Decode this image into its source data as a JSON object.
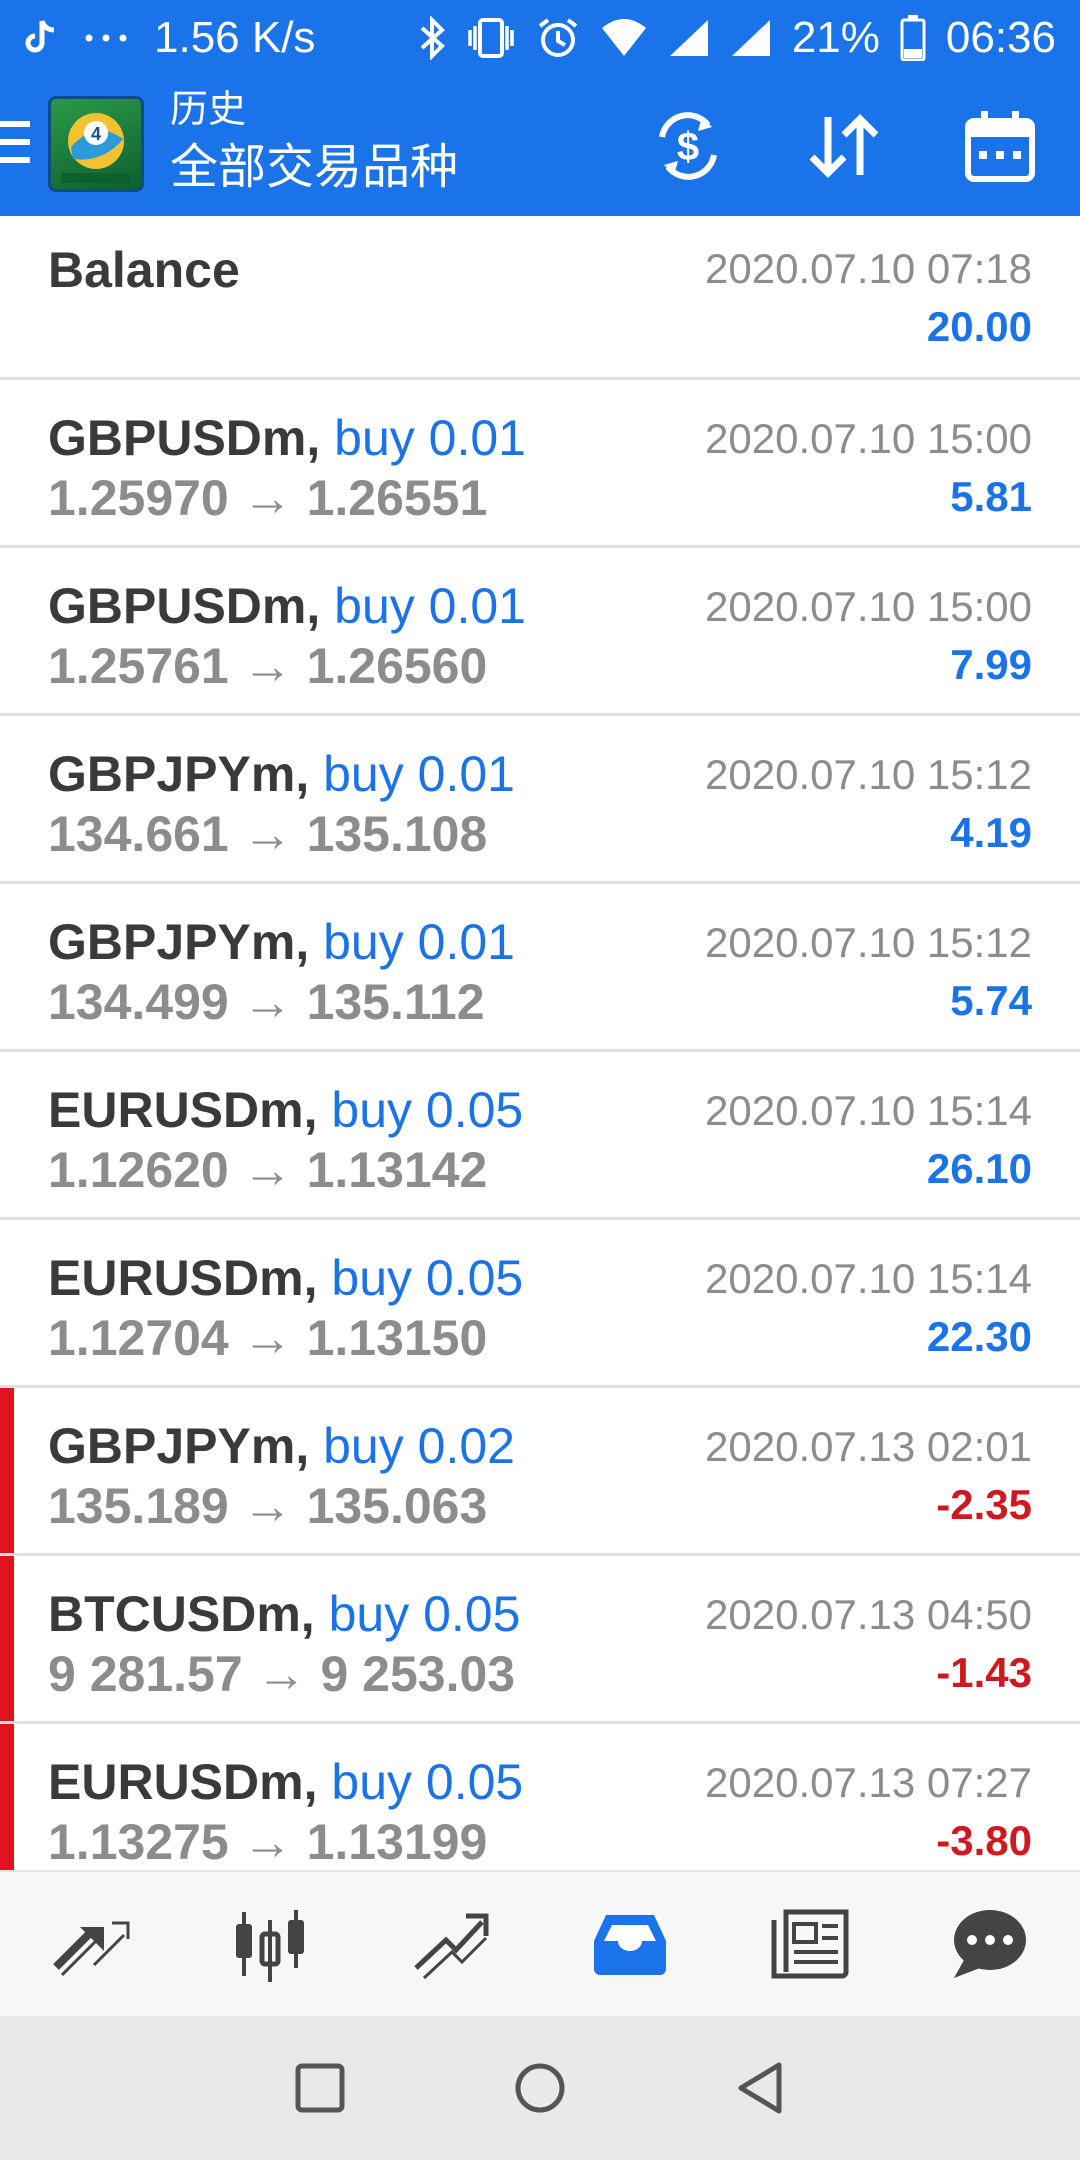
{
  "status_bar": {
    "net_speed": "1.56 K/s",
    "battery": "21%",
    "time": "06:36"
  },
  "app_bar": {
    "title": "历史",
    "subtitle": "全部交易品种"
  },
  "balance": {
    "label": "Balance",
    "date": "2020.07.10 07:18",
    "amount": "20.00"
  },
  "trades": [
    {
      "symbol": "GBPUSDm,",
      "type": "buy 0.01",
      "open": "1.25970",
      "close": "1.26551",
      "date": "2020.07.10 15:00",
      "profit": "5.81",
      "loss": false
    },
    {
      "symbol": "GBPUSDm,",
      "type": "buy 0.01",
      "open": "1.25761",
      "close": "1.26560",
      "date": "2020.07.10 15:00",
      "profit": "7.99",
      "loss": false
    },
    {
      "symbol": "GBPJPYm,",
      "type": "buy 0.01",
      "open": "134.661",
      "close": "135.108",
      "date": "2020.07.10 15:12",
      "profit": "4.19",
      "loss": false
    },
    {
      "symbol": "GBPJPYm,",
      "type": "buy 0.01",
      "open": "134.499",
      "close": "135.112",
      "date": "2020.07.10 15:12",
      "profit": "5.74",
      "loss": false
    },
    {
      "symbol": "EURUSDm,",
      "type": "buy 0.05",
      "open": "1.12620",
      "close": "1.13142",
      "date": "2020.07.10 15:14",
      "profit": "26.10",
      "loss": false
    },
    {
      "symbol": "EURUSDm,",
      "type": "buy 0.05",
      "open": "1.12704",
      "close": "1.13150",
      "date": "2020.07.10 15:14",
      "profit": "22.30",
      "loss": false
    },
    {
      "symbol": "GBPJPYm,",
      "type": "buy 0.02",
      "open": "135.189",
      "close": "135.063",
      "date": "2020.07.13 02:01",
      "profit": "-2.35",
      "loss": true
    },
    {
      "symbol": "BTCUSDm,",
      "type": "buy 0.05",
      "open": "9 281.57",
      "close": "9 253.03",
      "date": "2020.07.13 04:50",
      "profit": "-1.43",
      "loss": true
    },
    {
      "symbol": "EURUSDm,",
      "type": "buy 0.05",
      "open": "1.13275",
      "close": "1.13199",
      "date": "2020.07.13 07:27",
      "profit": "-3.80",
      "loss": true
    }
  ],
  "arrow": "→",
  "colors": {
    "accent": "#1a73e8",
    "loss": "#d0191f",
    "loss_bar": "#e0141e"
  },
  "icons": {
    "status": [
      "tiktok-icon",
      "more-icon",
      "bluetooth-icon",
      "vibrate-icon",
      "alarm-icon",
      "wifi-icon",
      "signal-icon",
      "signal-icon",
      "battery-icon"
    ],
    "app_bar": [
      "menu-icon",
      "currency-exchange-icon",
      "sort-icon",
      "calendar-icon"
    ],
    "tabs": [
      "quotes-icon",
      "chart-candles-icon",
      "trade-icon",
      "history-inbox-icon",
      "news-icon",
      "chat-icon"
    ],
    "system_nav": [
      "recents-icon",
      "home-icon",
      "back-icon"
    ]
  }
}
